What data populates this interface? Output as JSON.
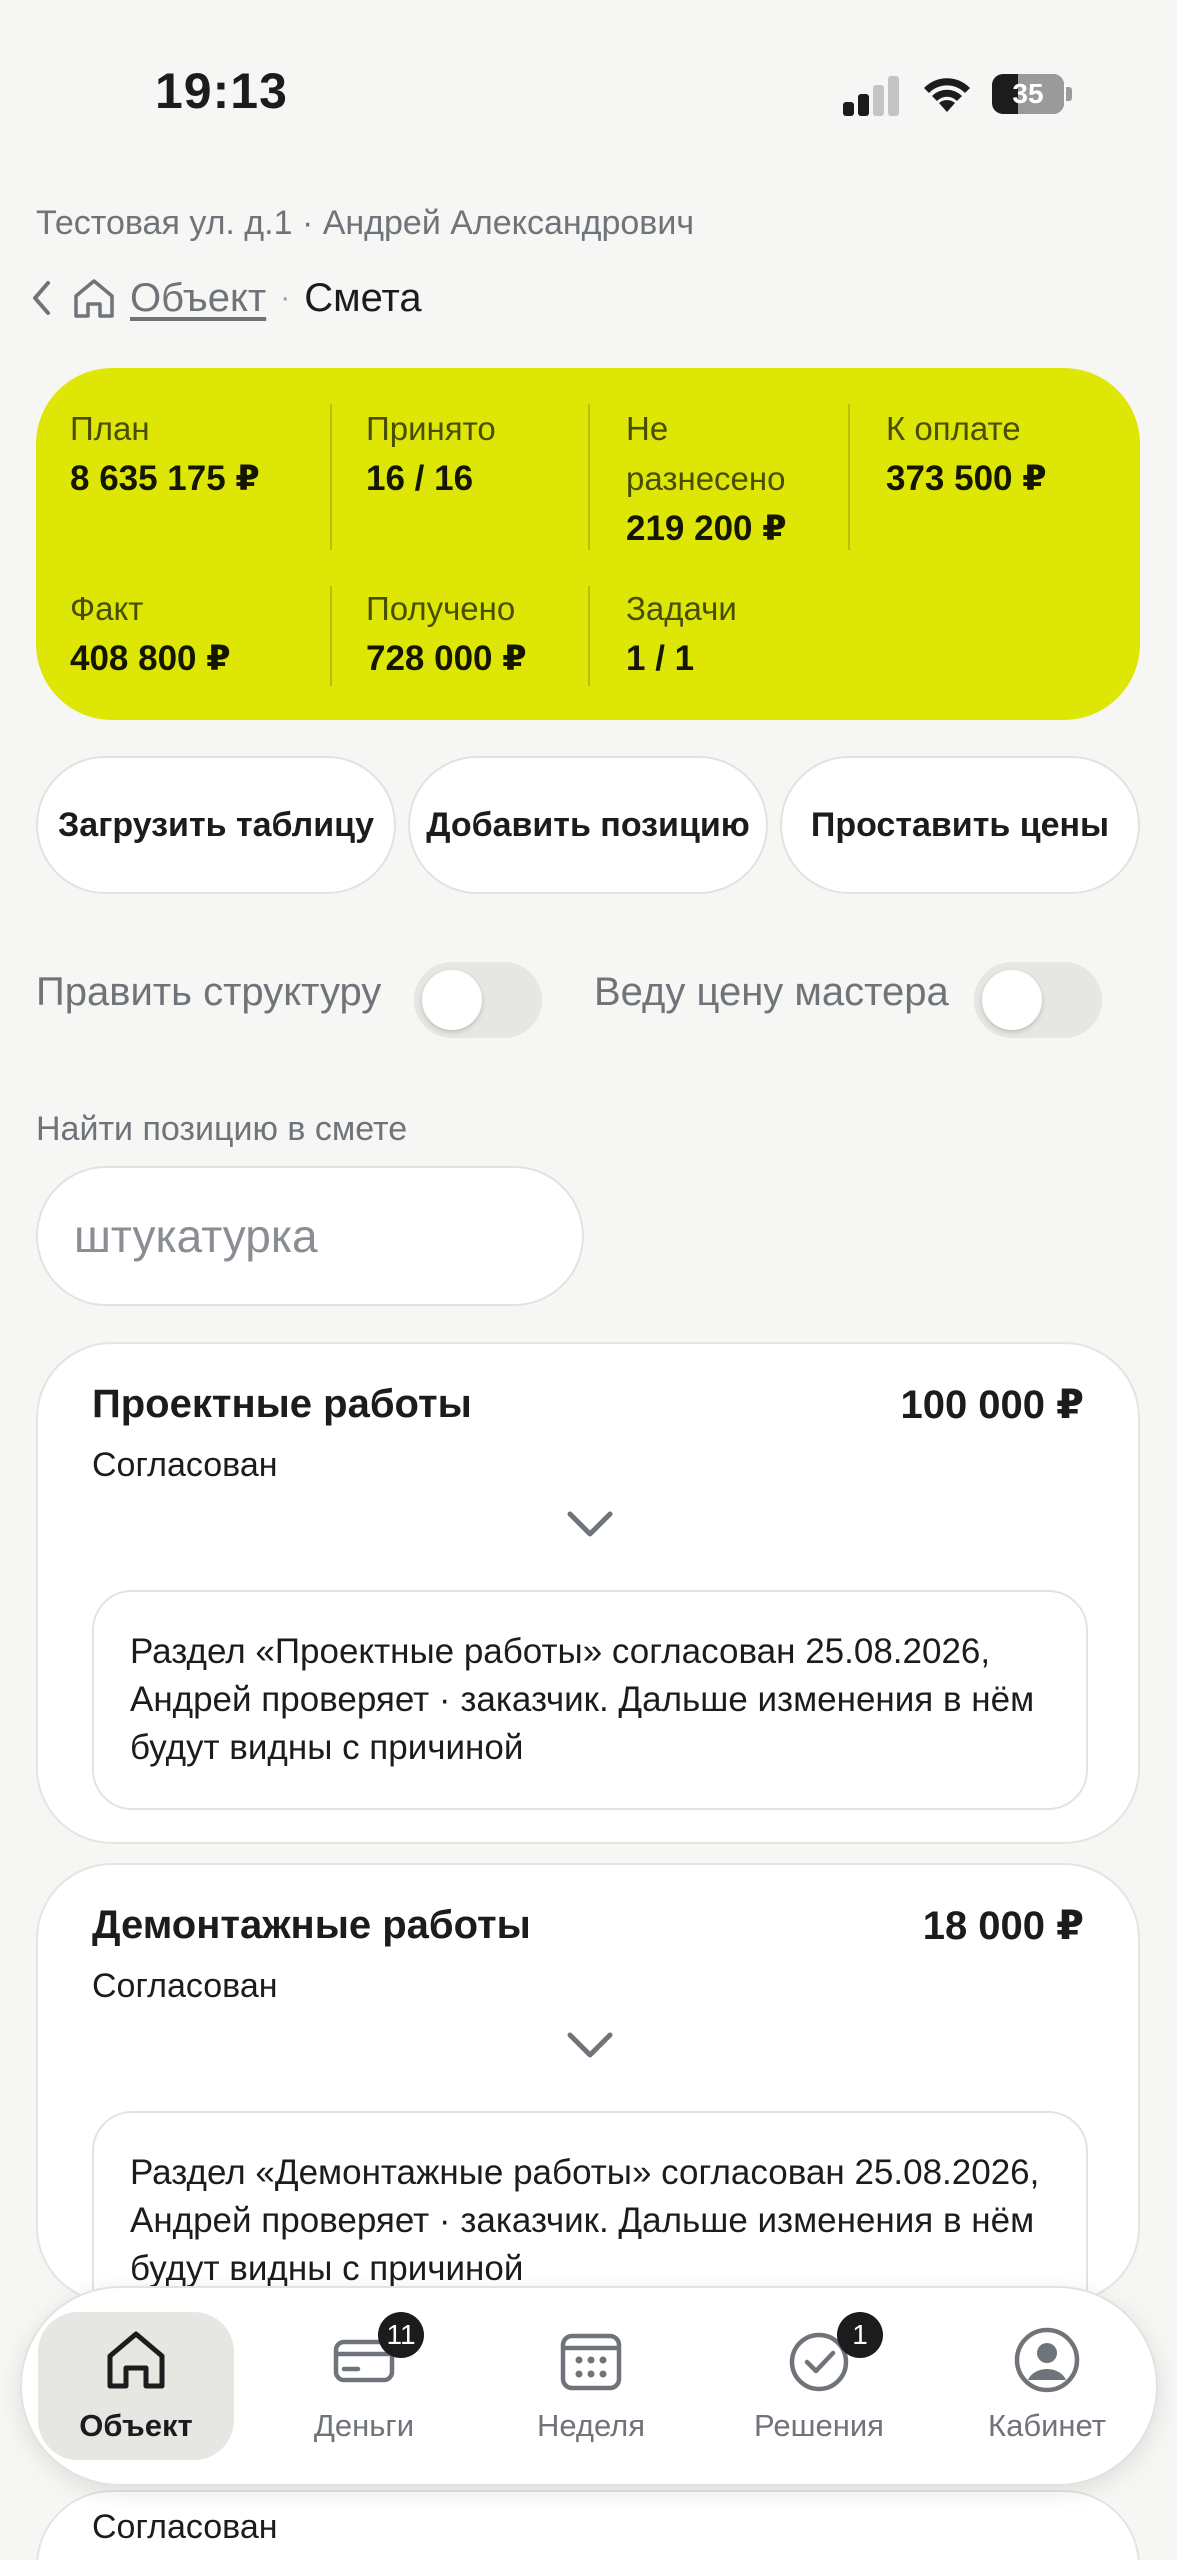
{
  "status_bar": {
    "time": "19:13",
    "battery": "35"
  },
  "header": {
    "address": "Тестовая ул. д.1 · Андрей Александрович",
    "breadcrumb_link": "Объект",
    "breadcrumb_sep": "·",
    "breadcrumb_current": "Смета"
  },
  "summary": {
    "plan_label": "План",
    "plan_value": "8 635 175 ₽",
    "accepted_label": "Принято",
    "accepted_value": "16 / 16",
    "unassigned_label_1": "Не",
    "unassigned_label_2": "разнесено",
    "unassigned_value": "219 200 ₽",
    "to_pay_label": "К оплате",
    "to_pay_value": "373 500 ₽",
    "fact_label": "Факт",
    "fact_value": "408 800 ₽",
    "received_label": "Получено",
    "received_value": "728 000 ₽",
    "tasks_label": "Задачи",
    "tasks_value": "1 / 1",
    "accent_color": "#dde605"
  },
  "actions": {
    "upload_table": "Загрузить таблицу",
    "add_position": "Добавить позицию",
    "set_prices": "Проставить цены"
  },
  "toggles": {
    "edit_structure": {
      "label": "Править структуру",
      "on": false
    },
    "master_price": {
      "label": "Веду цену мастера",
      "on": false
    }
  },
  "search": {
    "label": "Найти позицию в смете",
    "value": "штукатурка"
  },
  "sections": [
    {
      "title": "Проектные работы",
      "amount": "100 000 ₽",
      "status": "Согласован",
      "note": "Раздел «Проектные работы» согласован 25.08.2026, Андрей проверяет · заказчик. Дальше изменения в нём будут видны с причиной"
    },
    {
      "title": "Демонтажные работы",
      "amount": "18 000 ₽",
      "status": "Согласован",
      "note": "Раздел «Демонтажные работы» согласован 25.08.2026, Андрей проверяет · заказчик. Дальше изменения в нём будут видны с причиной"
    },
    {
      "status": "Согласован"
    }
  ],
  "nav": {
    "items": [
      {
        "label": "Объект",
        "icon": "home-icon",
        "active": true
      },
      {
        "label": "Деньги",
        "icon": "wallet-icon",
        "badge": "11"
      },
      {
        "label": "Неделя",
        "icon": "calendar-icon"
      },
      {
        "label": "Решения",
        "icon": "check-circle-icon",
        "badge": "1"
      },
      {
        "label": "Кабинет",
        "icon": "profile-icon"
      }
    ]
  }
}
